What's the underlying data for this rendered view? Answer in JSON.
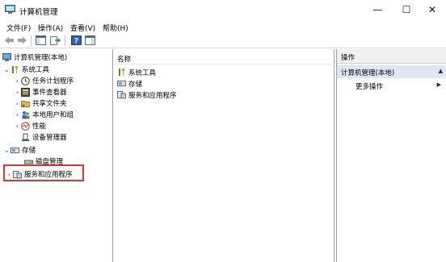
{
  "window": {
    "title": "计算机管理",
    "minimize_glyph": "—",
    "maximize_glyph": "☐",
    "close_glyph": "✕"
  },
  "menu": [
    "文件(F)",
    "操作(A)",
    "查看(V)",
    "帮助(H)"
  ],
  "toolbar": {
    "buttons": [
      "back-icon",
      "forward-icon",
      "show-hide-console-tree-icon",
      "export-list-icon",
      "help-icon",
      "action-pane-icon"
    ]
  },
  "tree": {
    "root": "计算机管理(本地)",
    "system_tools": "系统工具",
    "task_scheduler": "任务计划程序",
    "event_viewer": "事件查看器",
    "shared_folders": "共享文件夹",
    "local_users": "本地用户和组",
    "performance": "性能",
    "device_manager": "设备管理器",
    "storage": "存储",
    "disk_management": "磁盘管理",
    "services_apps": "服务和应用程序"
  },
  "middle": {
    "column_name": "名称",
    "items": [
      "系统工具",
      "存储",
      "服务和应用程序"
    ]
  },
  "actions": {
    "header": "操作",
    "selected": "计算机管理(本地)",
    "more": "更多操作"
  },
  "colors": {
    "highlight_border": "#d9343a",
    "action_selected_bg": "#dce6f4"
  }
}
